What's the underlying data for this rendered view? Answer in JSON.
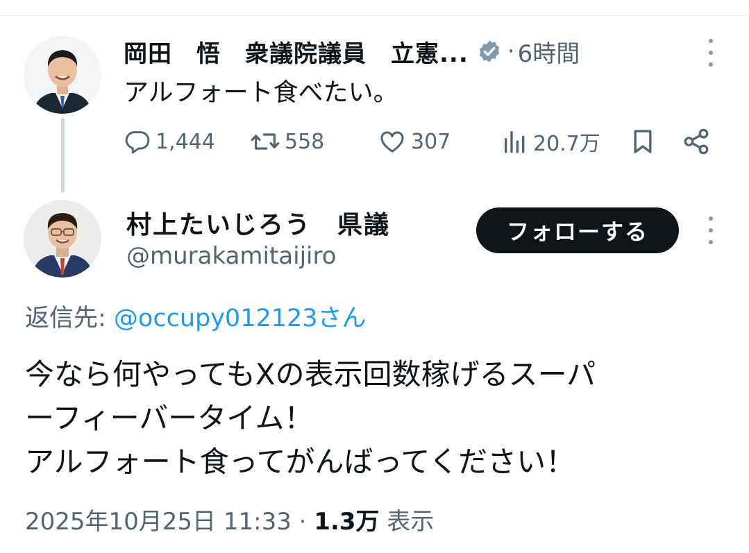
{
  "parent_tweet": {
    "author_name": "岡田　悟　衆議院議員　立憲...",
    "time": "6時間",
    "text": "アルフォート食べたい。",
    "stats": {
      "replies": "1,444",
      "retweets": "558",
      "likes": "307",
      "views": "20.7万"
    }
  },
  "main_tweet": {
    "author_name": "村上たいじろう　県議",
    "handle": "@murakamitaijiro",
    "follow_label": "フォローする",
    "reply_prefix": "返信先: ",
    "reply_target": "@occupy012123さん",
    "text_lines": [
      "今なら何やってもXの表示回数稼げるスーパ",
      "ーフィーバータイム！",
      "アルフォート食ってがんばってください！"
    ],
    "timestamp": "2025年10月25日 11:33",
    "views_count": "1.3万",
    "views_label": "表示"
  },
  "icons": {
    "verified": "verified-badge-icon",
    "reply": "reply-icon",
    "retweet": "retweet-icon",
    "like": "heart-icon",
    "views": "bar-chart-icon",
    "bookmark": "bookmark-icon",
    "share": "share-icon",
    "more": "more-vertical-icon"
  },
  "colors": {
    "text": "#0f1419",
    "secondary": "#536471",
    "link": "#1d9bf0",
    "button_bg": "#0f1419",
    "verified": "#829aab"
  }
}
